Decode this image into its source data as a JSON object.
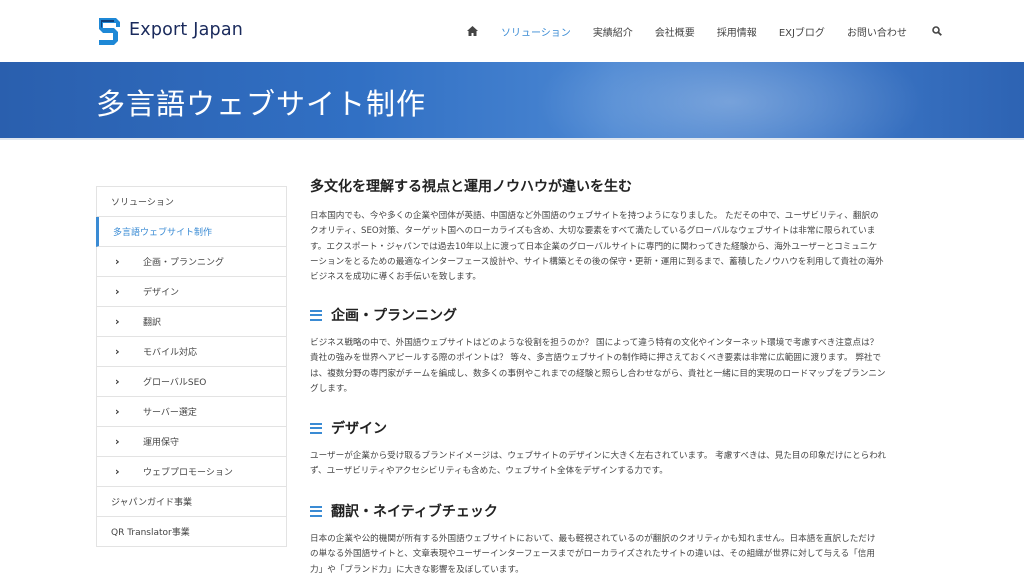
{
  "header": {
    "logo_text": "Export Japan",
    "nav": [
      {
        "label": "ソリューション"
      },
      {
        "label": "実績紹介"
      },
      {
        "label": "会社概要"
      },
      {
        "label": "採用情報"
      },
      {
        "label": "EXJブログ"
      },
      {
        "label": "お問い合わせ"
      }
    ],
    "home_icon": "home-icon",
    "search_icon": "search-icon",
    "accent_color": "#3a8bd4"
  },
  "banner": {
    "title": "多言語ウェブサイト制作"
  },
  "sidebar": {
    "items": [
      {
        "label": "ソリューション"
      },
      {
        "label": "多言語ウェブサイト制作"
      },
      {
        "label": "企画・プランニング"
      },
      {
        "label": "デザイン"
      },
      {
        "label": "翻訳"
      },
      {
        "label": "モバイル対応"
      },
      {
        "label": "グローバルSEO"
      },
      {
        "label": "サーバー選定"
      },
      {
        "label": "運用保守"
      },
      {
        "label": "ウェブプロモーション"
      },
      {
        "label": "ジャパンガイド事業"
      },
      {
        "label": "QR Translator事業"
      }
    ]
  },
  "main": {
    "heading": "多文化を理解する視点と運用ノウハウが違いを生む",
    "intro": [
      "日本国内でも、今や多くの企業や団体が英語、中国語など外国語のウェブサイトを持つようになりました。 ただその中で、ユーザビリティ、翻訳の",
      "クオリティ、SEO対策、ターゲット国へのローカライズも含め、大切な要素をすべて満たしているグローバルなウェブサイトは非常に限られていま",
      "す。エクスポート・ジャパンでは過去10年以上に渡って日本企業のグローバルサイトに専門的に関わってきた経験から、海外ユーザーとコミュニケ",
      "ーションをとるための最適なインターフェース設計や、サイト構築とその後の保守・更新・運用に到るまで、蓄積したノウハウを利用して貴社の海外",
      "ビジネスを成功に導くお手伝いを致します。"
    ],
    "sections": [
      {
        "title": "企画・プランニング",
        "lines": [
          "ビジネス戦略の中で、外国語ウェブサイトはどのような役割を担うのか？ 国によって違う特有の文化やインターネット環境で考慮すべき注意点は？",
          "貴社の強みを世界へアピールする際のポイントは？ 等々、多言語ウェブサイトの制作時に押さえておくべき要素は非常に広範囲に渡ります。 弊社で",
          "は、複数分野の専門家がチームを編成し、数多くの事例やこれまでの経験と照らし合わせながら、貴社と一緒に目的実現のロードマップをプランニン",
          "グします。"
        ]
      },
      {
        "title": "デザイン",
        "lines": [
          "ユーザーが企業から受け取るブランドイメージは、ウェブサイトのデザインに大きく左右されています。 考慮すべきは、見た目の印象だけにとらわれ",
          "ず、ユーザビリティやアクセシビリティも含めた、ウェブサイト全体をデザインする力です。"
        ]
      },
      {
        "title": "翻訳・ネイティブチェック",
        "lines": [
          "日本の企業や公的機関が所有する外国語ウェブサイトにおいて、最も軽視されているのが翻訳のクオリティかも知れません。日本語を直訳しただけ",
          "の単なる外国語サイトと、文章表現やユーザーインターフェースまでがローカライズされたサイトの違いは、その組織が世界に対して与える「信用",
          "力」や「ブランド力」に大きな影響を及ぼしています。"
        ]
      }
    ]
  }
}
